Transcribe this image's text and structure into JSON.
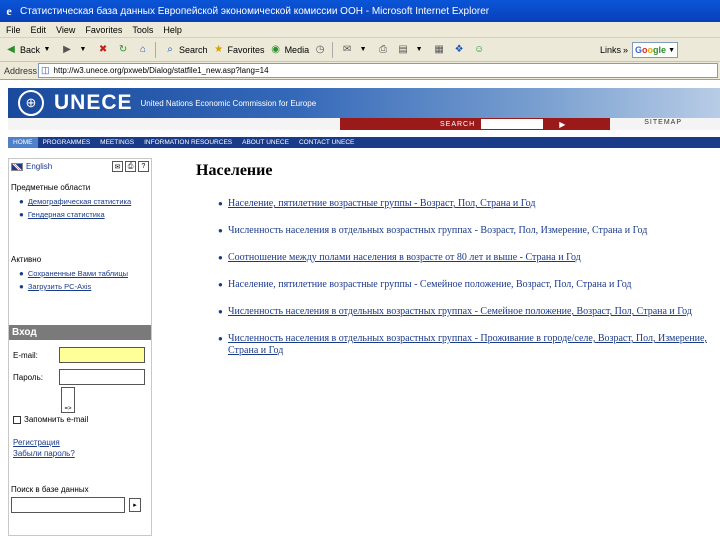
{
  "window": {
    "title": "Статистическая база данных Европейской экономической комиссии ООН - Microsoft Internet Explorer"
  },
  "menu": [
    "File",
    "Edit",
    "View",
    "Favorites",
    "Tools",
    "Help"
  ],
  "toolbar": {
    "back": "Back",
    "search": "Search",
    "favorites": "Favorites",
    "media": "Media",
    "links": "Links",
    "google_g": "G",
    "google_o1": "o",
    "google_o2": "o",
    "google_rest": "gle"
  },
  "address": {
    "label": "Address",
    "url": "http://w3.unece.org/pxweb/Dialog/statfile1_new.asp?lang=14"
  },
  "banner": {
    "logo_text": "UNECE",
    "subtitle": "United Nations Economic Commission for Europe"
  },
  "search": {
    "label": "SEARCH",
    "go": "▶",
    "sitemap": "SITEMAP"
  },
  "nav": [
    "HOME",
    "PROGRAMMES",
    "MEETINGS",
    "INFORMATION RESOURCES",
    "ABOUT UNECE",
    "CONTACT UNECE"
  ],
  "sidebar": {
    "language": "English",
    "subject_heading": "Предметные области",
    "subject_links": [
      "Демографическая статистика",
      "Гендерная статистика"
    ],
    "actions_heading": "Активно",
    "action_links": [
      "Сохраненные Вами таблицы",
      "Загрузить PC-Axis"
    ],
    "login_heading": "Вход",
    "email_label": "E-mail:",
    "password_label": "Пароль:",
    "login_button": "=>",
    "remember_label": "Запомнить e-mail",
    "register_link": "Регистрация",
    "forgot_link": "Забыли пароль?",
    "db_search_label": "Поиск в базе данных"
  },
  "main": {
    "title": "Население",
    "items": [
      {
        "link": "Население, пятилетние возрастные группы - Возраст, Пол, Страна и Год",
        "rest": ""
      },
      {
        "link": "",
        "rest": "Численность населения в отдельных возрастных группах - Возраст, Пол, Измерение, Страна и Год"
      },
      {
        "link": "Соотношение между полами населения в возрасте от 80 лет и выше - Страна и Год",
        "rest": ""
      },
      {
        "link": "",
        "rest": "Население, пятилетние возрастные группы - Семейное положение, Возраст, Пол, Страна и Год"
      },
      {
        "link": "Численность населения в отдельных возрастных группах - Семейное положение, Возраст, Пол, Страна и Год",
        "rest": ""
      },
      {
        "link": "Численность населения в отдельных возрастных группах - Проживание в городе/селе, Возраст, Пол, Измерение, Страна и Год",
        "rest": ""
      }
    ]
  },
  "colors": {
    "link": "#1a3a8a",
    "banner": "#1a4a9c",
    "search_bar": "#9a1a1a",
    "nav": "#1a3a8a",
    "email_field": "#ffff99"
  }
}
